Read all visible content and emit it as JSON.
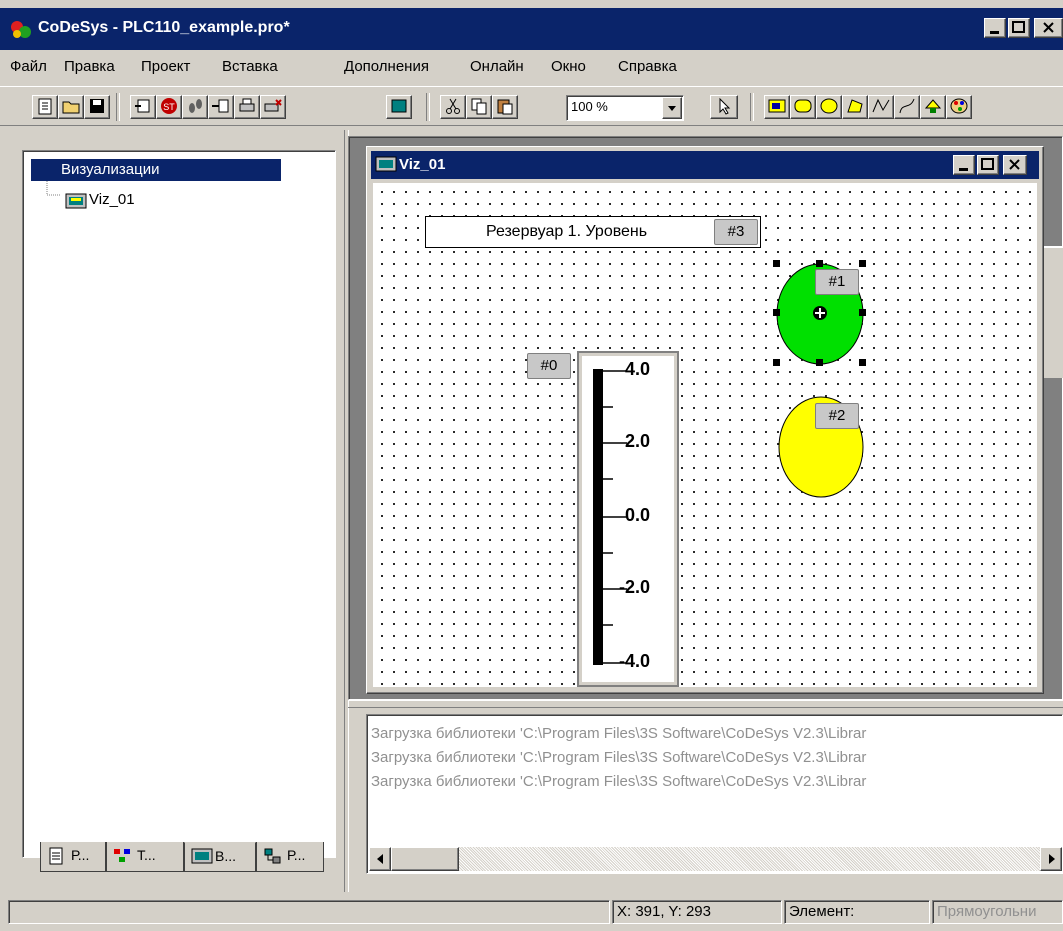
{
  "window": {
    "title": "CoDeSys - PLC110_example.pro*"
  },
  "menu": [
    "Файл",
    "Правка",
    "Проект",
    "Вставка",
    "Дополнения",
    "Онлайн",
    "Окно",
    "Справка"
  ],
  "toolbar": {
    "zoom_value": "100 %",
    "buttons": [
      "new-icon",
      "open-icon",
      "save-icon",
      "build-icon",
      "stop-icon",
      "step-icon",
      "login-icon",
      "print-icon",
      "print-preview-icon",
      "cut-icon",
      "copy-icon",
      "paste-icon",
      "select-arrow-icon",
      "rectangle-tool-icon",
      "rounded-rect-tool-icon",
      "ellipse-tool-icon",
      "polygon-tool-icon",
      "polyline-tool-icon",
      "curve-tool-icon",
      "bitmap-tool-icon",
      "color-palette-icon"
    ]
  },
  "tree": {
    "root_label": "Визуализации",
    "child_label": "Viz_01"
  },
  "tabs": [
    "Р...",
    "Т...",
    "В...",
    "Р..."
  ],
  "viz": {
    "title": "Viz_01",
    "text_element": "Резервуар 1. Уровень",
    "tags": [
      "#0",
      "#1",
      "#2",
      "#3"
    ],
    "scale_labels": [
      "4.0",
      "2.0",
      "0.0",
      "-2.0",
      "-4.0"
    ]
  },
  "messages": [
    "Загрузка библиотеки 'C:\\Program Files\\3S Software\\CoDeSys V2.3\\Librar",
    "Загрузка библиотеки 'C:\\Program Files\\3S Software\\CoDeSys V2.3\\Librar",
    "Загрузка библиотеки 'C:\\Program Files\\3S Software\\CoDeSys V2.3\\Librar"
  ],
  "status": {
    "coords": "X:   391, Y:   293",
    "element_label": "Элемент:",
    "element_value": "Прямоугольни"
  },
  "colors": {
    "titlebar": "#0a246a",
    "green_ellipse": "#00e000",
    "yellow_ellipse": "#ffff00"
  }
}
